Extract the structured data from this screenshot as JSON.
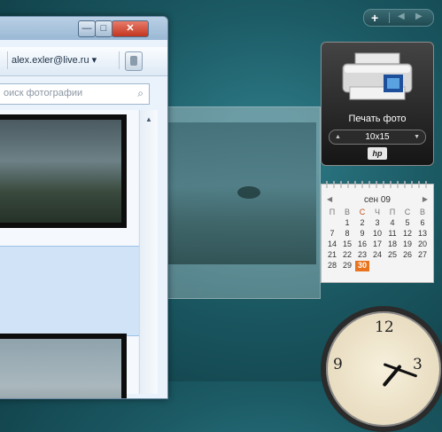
{
  "window": {
    "account_email": "alex.exler@live.ru",
    "account_arrow": "▾",
    "search_placeholder": "оиск фотографии",
    "minimize_symbol": "—",
    "maximize_symbol": "□",
    "close_symbol": "✕"
  },
  "sidebar": {
    "add_symbol": "+",
    "prev_symbol": "◀",
    "next_symbol": "▶"
  },
  "print_gadget": {
    "title": "Печать фото",
    "size_value": "10x15",
    "brand": "hp"
  },
  "calendar": {
    "month_label": "сен 09",
    "weekdays": [
      "П",
      "В",
      "С",
      "Ч",
      "П",
      "С",
      "В"
    ],
    "days": [
      "",
      "1",
      "2",
      "3",
      "4",
      "5",
      "6",
      "7",
      "8",
      "9",
      "10",
      "11",
      "12",
      "13",
      "14",
      "15",
      "16",
      "17",
      "18",
      "19",
      "20",
      "21",
      "22",
      "23",
      "24",
      "25",
      "26",
      "27",
      "28",
      "29",
      "30",
      "",
      "",
      "",
      ""
    ],
    "today": "30"
  },
  "clock": {
    "n12": "12",
    "n3": "3",
    "n9": "9"
  }
}
